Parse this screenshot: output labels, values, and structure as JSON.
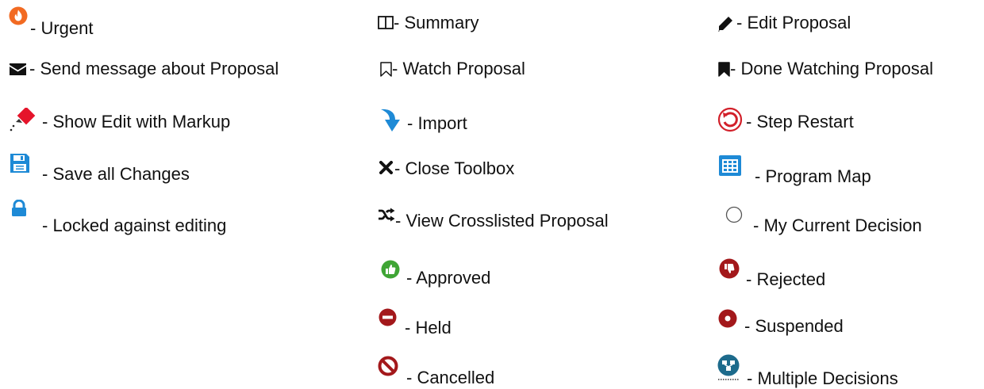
{
  "legend": {
    "col1": [
      {
        "name": "urgent",
        "label": "- Urgent",
        "icon": "fire-icon"
      },
      {
        "name": "send-message",
        "label": "- Send message about Proposal",
        "icon": "envelope-icon"
      },
      {
        "name": "show-edit-markup",
        "label": "- Show Edit with Markup",
        "icon": "eraser-markup-icon"
      },
      {
        "name": "save-all",
        "label": "- Save all Changes",
        "icon": "floppy-disk-icon"
      },
      {
        "name": "locked",
        "label": "- Locked against editing",
        "icon": "lock-icon"
      }
    ],
    "col2": [
      {
        "name": "summary",
        "label": "- Summary",
        "icon": "columns-icon"
      },
      {
        "name": "watch",
        "label": "- Watch Proposal",
        "icon": "bookmark-outline-icon"
      },
      {
        "name": "import",
        "label": "- Import",
        "icon": "curved-arrow-down-icon"
      },
      {
        "name": "close-toolbox",
        "label": "- Close Toolbox",
        "icon": "close-x-icon"
      },
      {
        "name": "view-crosslisted",
        "label": "- View Crosslisted Proposal",
        "icon": "shuffle-icon"
      },
      {
        "name": "approved",
        "label": "- Approved",
        "icon": "thumbs-up-icon"
      },
      {
        "name": "held",
        "label": "- Held",
        "icon": "minus-circle-icon"
      },
      {
        "name": "cancelled",
        "label": "- Cancelled",
        "icon": "ban-icon"
      }
    ],
    "col3": [
      {
        "name": "edit-proposal",
        "label": "- Edit Proposal",
        "icon": "pencil-icon"
      },
      {
        "name": "done-watching",
        "label": "- Done Watching Proposal",
        "icon": "bookmark-filled-icon"
      },
      {
        "name": "step-restart",
        "label": "- Step Restart",
        "icon": "restart-icon"
      },
      {
        "name": "program-map",
        "label": "- Program Map",
        "icon": "grid-table-icon"
      },
      {
        "name": "my-current-decision",
        "label": "- My Current Decision",
        "icon": "empty-circle-icon"
      },
      {
        "name": "rejected",
        "label": "- Rejected",
        "icon": "thumbs-down-icon"
      },
      {
        "name": "suspended",
        "label": "- Suspended",
        "icon": "dot-circle-icon"
      },
      {
        "name": "multiple-decisions",
        "label": "- Multiple Decisions",
        "icon": "multiple-decisions-icon"
      }
    ]
  },
  "colors": {
    "urgent_orange": "#f26a22",
    "blue": "#1e8ad6",
    "dark_red": "#a3181b",
    "green": "#3fa535",
    "restart_red": "#d2202a",
    "teal": "#1d6b8c"
  }
}
